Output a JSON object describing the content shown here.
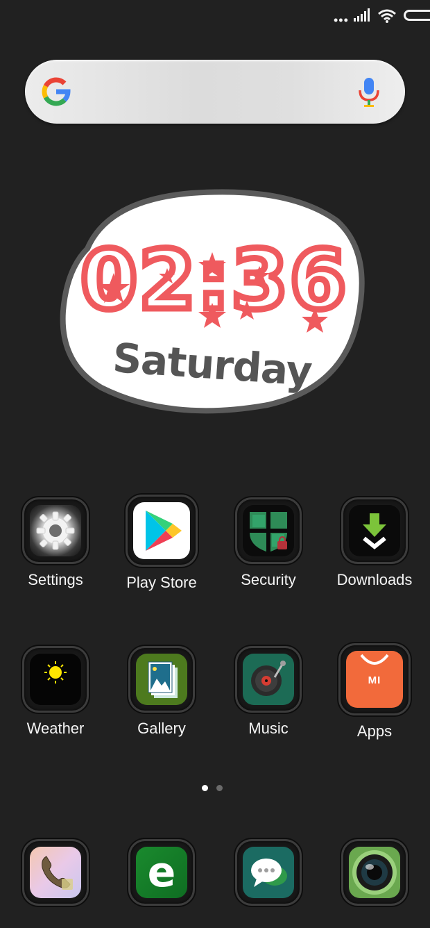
{
  "status_bar": {
    "dots": "•••",
    "icons": [
      "signal-icon",
      "wifi-icon",
      "battery-icon"
    ]
  },
  "search": {
    "logo": "G",
    "icons": [
      "google-logo-icon",
      "mic-icon"
    ]
  },
  "clock": {
    "time": "02:36",
    "day": "Saturday",
    "colors": {
      "digits": "#ef5a5e",
      "day": "#555555",
      "bubble": "#ffffff"
    }
  },
  "apps": [
    {
      "label": "Settings",
      "icon": "gear-icon"
    },
    {
      "label": "Play Store",
      "icon": "play-store-icon"
    },
    {
      "label": "Security",
      "icon": "shield-icon"
    },
    {
      "label": "Downloads",
      "icon": "download-arrow-icon"
    },
    {
      "label": "Weather",
      "icon": "sun-icon"
    },
    {
      "label": "Gallery",
      "icon": "gallery-icon"
    },
    {
      "label": "Music",
      "icon": "turntable-icon"
    },
    {
      "label": "Apps",
      "icon": "shopping-bag-icon",
      "badge": "MI"
    }
  ],
  "page_indicator": {
    "pages": 2,
    "active": 1
  },
  "dock": [
    {
      "icon": "phone-icon"
    },
    {
      "icon": "browser-icon",
      "glyph": "e"
    },
    {
      "icon": "messages-icon"
    },
    {
      "icon": "camera-icon"
    }
  ]
}
